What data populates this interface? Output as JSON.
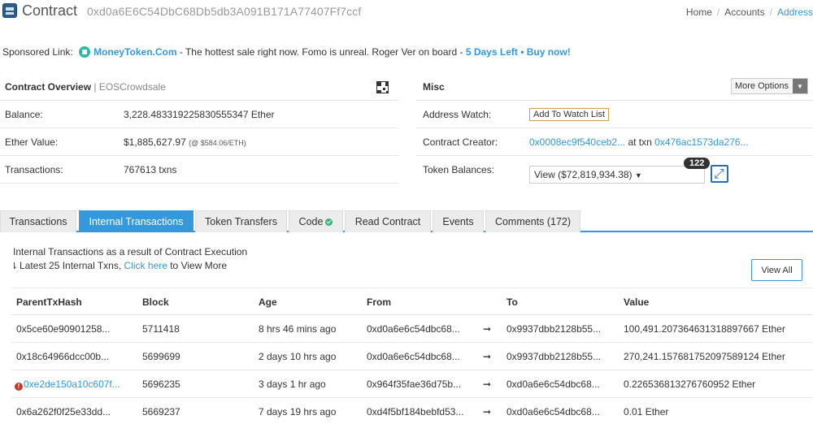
{
  "header": {
    "title": "Contract",
    "address": "0xd0a6E6C54DbC68Db5db3A091B171A77407Ff7ccf",
    "breadcrumb": [
      "Home",
      "Accounts",
      "Address"
    ]
  },
  "sponsored": {
    "label": "Sponsored Link:",
    "brand": "MoneyToken.Com",
    "text": " - The hottest sale right now. Fomo is unreal. Roger Ver on board - ",
    "cta": "5 Days Left • Buy now!"
  },
  "overview": {
    "title": "Contract Overview",
    "subtitle": "| EOSCrowdsale",
    "balance_label": "Balance:",
    "balance_value": "3,228.483319225830555347 Ether",
    "ether_value_label": "Ether Value:",
    "ether_value": "$1,885,627.97",
    "ether_rate": "(@ $584.06/ETH)",
    "transactions_label": "Transactions:",
    "transactions_value": "767613 txns"
  },
  "misc": {
    "title": "Misc",
    "more_options": "More Options",
    "address_watch_label": "Address Watch:",
    "add_watch": "Add To Watch List",
    "creator_label": "Contract Creator:",
    "creator_address": "0x0008ec9f540ceb2...",
    "creator_at_txn": "at txn",
    "creator_txn": "0x476ac1573da276...",
    "token_balances_label": "Token Balances:",
    "token_select": "View ($72,819,934.38)",
    "token_count": "122"
  },
  "tabs": [
    {
      "label": "Transactions",
      "active": false
    },
    {
      "label": "Internal Transactions",
      "active": true
    },
    {
      "label": "Token Transfers",
      "active": false
    },
    {
      "label": "Code",
      "active": false
    },
    {
      "label": "Read Contract",
      "active": false
    },
    {
      "label": "Events",
      "active": false
    },
    {
      "label": "Comments (172)",
      "active": false
    }
  ],
  "internal": {
    "caption": "Internal Transactions as a result of Contract Execution",
    "latest_prefix": "Latest 25 Internal Txns, ",
    "click_here": "Click here",
    "latest_suffix": " to View More",
    "view_all": "View All",
    "columns": [
      "ParentTxHash",
      "Block",
      "Age",
      "From",
      "To",
      "Value"
    ],
    "rows": [
      {
        "hash": "0x5ce60e90901258...",
        "error": false,
        "block": "5711418",
        "age": "8 hrs 46 mins ago",
        "from": "0xd0a6e6c54dbc68...",
        "from_link": false,
        "arrow": "➞",
        "to": "0x9937dbb2128b55...",
        "to_link": true,
        "value": "100,491.207364631318897667 Ether"
      },
      {
        "hash": "0x18c64966dcc00b...",
        "error": false,
        "block": "5699699",
        "age": "2 days 10 hrs ago",
        "from": "0xd0a6e6c54dbc68...",
        "from_link": false,
        "arrow": "➞",
        "to": "0x9937dbb2128b55...",
        "to_link": true,
        "value": "270,241.157681752097589124 Ether"
      },
      {
        "hash": "0xe2de150a10c607f...",
        "error": true,
        "block": "5696235",
        "age": "3 days 1 hr ago",
        "from": "0x964f35fae36d75b...",
        "from_link": true,
        "arrow": "➞",
        "to": "0xd0a6e6c54dbc68...",
        "to_link": false,
        "value": "0.226536813276760952 Ether"
      },
      {
        "hash": "0x6a262f0f25e33dd...",
        "error": false,
        "block": "5669237",
        "age": "7 days 19 hrs ago",
        "from": "0xd4f5bf184bebfd53...",
        "from_link": true,
        "arrow": "➞",
        "to": "0xd0a6e6c54dbc68...",
        "to_link": false,
        "value": "0.01 Ether"
      }
    ]
  }
}
